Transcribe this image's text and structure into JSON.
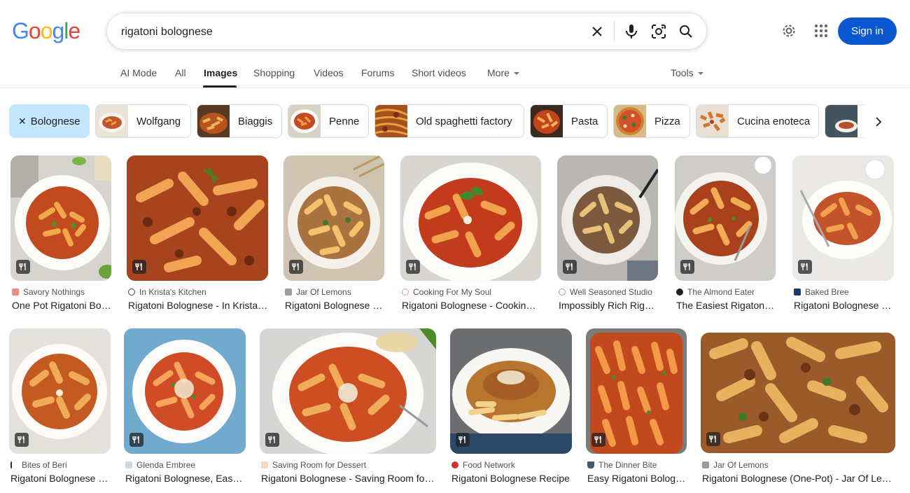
{
  "logo": [
    "G",
    "o",
    "o",
    "g",
    "l",
    "e"
  ],
  "logo_colors": [
    "#4285f4",
    "#ea4335",
    "#fbbc05",
    "#4285f4",
    "#34a853",
    "#ea4335"
  ],
  "search": {
    "value": "rigatoni bolognese"
  },
  "header": {
    "signin_label": "Sign in"
  },
  "tabs": [
    {
      "label": "AI Mode"
    },
    {
      "label": "All"
    },
    {
      "label": "Images"
    },
    {
      "label": "Shopping"
    },
    {
      "label": "Videos"
    },
    {
      "label": "Forums"
    },
    {
      "label": "Short videos"
    },
    {
      "label": "More"
    },
    {
      "label": "Tools"
    }
  ],
  "chips": [
    {
      "label": "Bolognese"
    },
    {
      "label": "Wolfgang"
    },
    {
      "label": "Biaggis"
    },
    {
      "label": "Penne"
    },
    {
      "label": "Old spaghetti factory"
    },
    {
      "label": "Pasta"
    },
    {
      "label": "Pizza"
    },
    {
      "label": "Cucina enoteca"
    }
  ],
  "results": [
    {
      "source": "Savory Nothings",
      "title": "One Pot Rigatoni Bolognese"
    },
    {
      "source": "In Krista's Kitchen",
      "title": "Rigatoni Bolognese - In Krista's Kitchen"
    },
    {
      "source": "Jar Of Lemons",
      "title": "Rigatoni Bolognese (One-Pot)"
    },
    {
      "source": "Cooking For My Soul",
      "title": "Rigatoni Bolognese - Cooking For My Soul"
    },
    {
      "source": "Well Seasoned Studio",
      "title": "Impossibly Rich Rigatoni Bolognese"
    },
    {
      "source": "The Almond Eater",
      "title": "The Easiest Rigatoni Bolognese"
    },
    {
      "source": "Baked Bree",
      "title": "Rigatoni Bolognese - Baked Bree"
    },
    {
      "source": "Bites of Beri",
      "title": "Rigatoni Bolognese - Bites of Beri"
    },
    {
      "source": "Glenda Embree",
      "title": "Rigatoni Bolognese, Easy and Hearty"
    },
    {
      "source": "Saving Room for Dessert",
      "title": "Rigatoni Bolognese - Saving Room for Dessert"
    },
    {
      "source": "Food Network",
      "title": "Rigatoni Bolognese Recipe"
    },
    {
      "source": "The Dinner Bite",
      "title": "Easy Rigatoni Bolognese"
    },
    {
      "source": "Jar Of Lemons",
      "title": "Rigatoni Bolognese (One-Pot) - Jar Of Lemons"
    }
  ],
  "colors": {
    "accent": "#0b57d0",
    "chip_selected": "#c2e7ff",
    "sauce": "#b8431f",
    "pasta": "#e8a54a"
  }
}
